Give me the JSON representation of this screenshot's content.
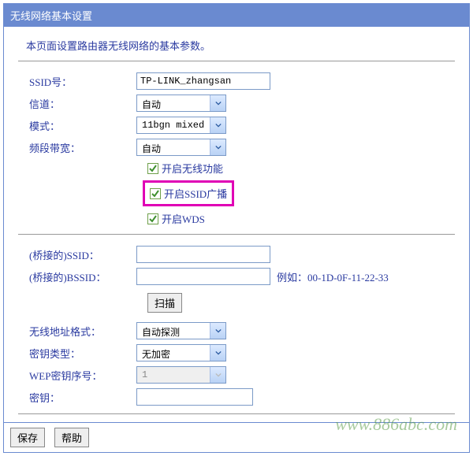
{
  "panel": {
    "title": "无线网络基本设置",
    "intro": "本页面设置路由器无线网络的基本参数。"
  },
  "fields": {
    "ssid_label": "SSID号：",
    "ssid_value": "TP-LINK_zhangsan",
    "channel_label": "信道：",
    "channel_value": "自动",
    "mode_label": "模式：",
    "mode_value": "11bgn mixed",
    "bandwidth_label": "频段带宽：",
    "bandwidth_value": "自动",
    "enable_wireless": "开启无线功能",
    "enable_ssid_broadcast": "开启SSID广播",
    "enable_wds": "开启WDS",
    "bridge_ssid_label": "(桥接的)SSID：",
    "bridge_ssid_value": "",
    "bridge_bssid_label": "(桥接的)BSSID：",
    "bridge_bssid_value": "",
    "bssid_hint": "例如：00-1D-0F-11-22-33",
    "scan_label": "扫描",
    "addr_fmt_label": "无线地址格式：",
    "addr_fmt_value": "自动探测",
    "enc_type_label": "密钥类型：",
    "enc_type_value": "无加密",
    "wep_index_label": "WEP密钥序号：",
    "wep_index_value": "1",
    "key_label": "密钥：",
    "key_value": ""
  },
  "buttons": {
    "save": "保存",
    "help": "帮助"
  },
  "watermark": "www.886abc.com"
}
